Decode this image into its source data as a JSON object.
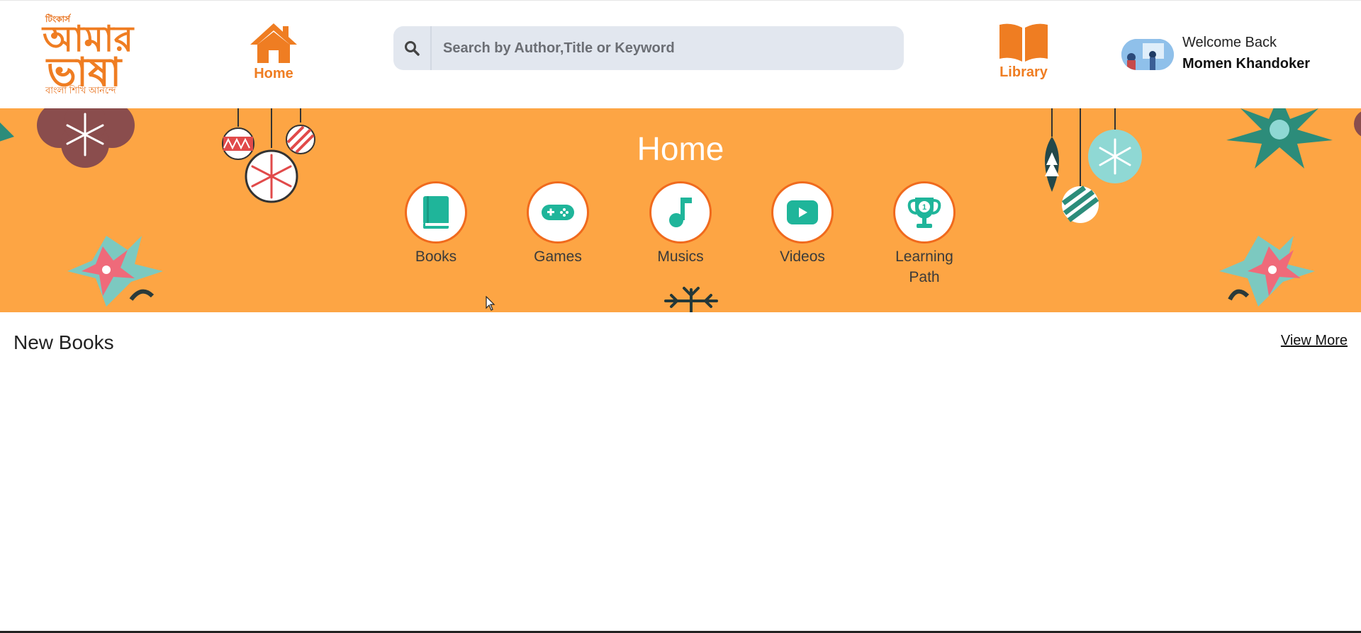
{
  "header": {
    "logo": {
      "small_text": "টিংকার্স",
      "line1": "আমার",
      "line2": "ভাষা",
      "tagline": "বাংলা শিখি আনন্দে"
    },
    "nav_home_label": "Home",
    "nav_library_label": "Library",
    "search": {
      "placeholder": "Search by Author,Title or Keyword",
      "value": ""
    },
    "user": {
      "welcome": "Welcome Back",
      "name": "Momen Khandoker"
    }
  },
  "banner": {
    "title": "Home",
    "categories": [
      {
        "label": "Books",
        "icon": "book-icon"
      },
      {
        "label": "Games",
        "icon": "gamepad-icon"
      },
      {
        "label": "Musics",
        "icon": "music-note-icon"
      },
      {
        "label": "Videos",
        "icon": "play-icon"
      },
      {
        "label": "Learning Path",
        "icon": "trophy-icon"
      }
    ]
  },
  "section": {
    "title": "New Books",
    "view_more": "View More"
  },
  "colors": {
    "brand_orange": "#ef7d22",
    "banner_bg": "#fda544",
    "icon_teal": "#1fb59a",
    "circle_border": "#f06a1d",
    "search_bg": "#e2e7ef"
  }
}
